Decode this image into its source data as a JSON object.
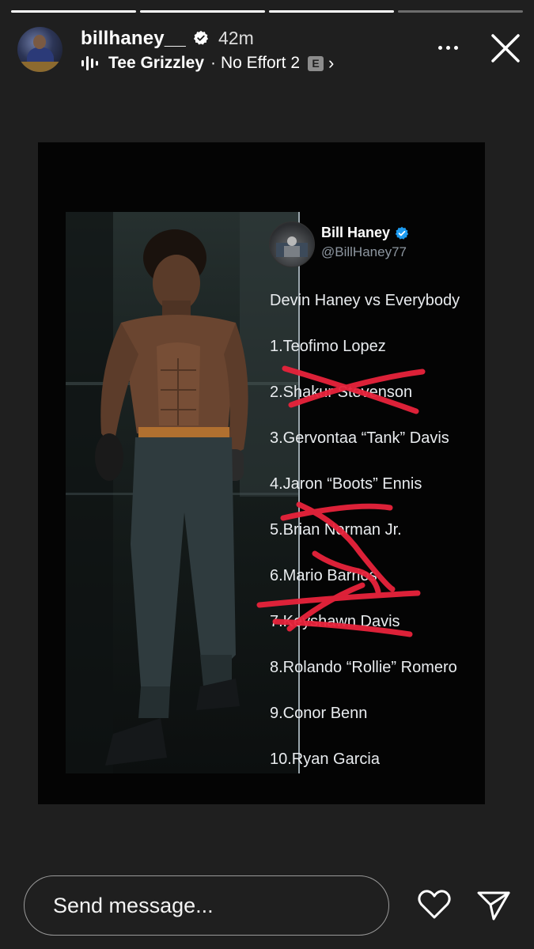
{
  "story": {
    "segments": [
      true,
      true,
      true,
      false
    ]
  },
  "header": {
    "username": "billhaney__",
    "time_ago": "42m",
    "music_artist": "Tee Grizzley",
    "music_separator": "·",
    "music_track": "No Effort 2",
    "explicit_label": "E",
    "chevron": "›"
  },
  "post": {
    "author_name": "Bill Haney",
    "author_handle": "@BillHaney77",
    "headline": "Devin Haney vs Everybody",
    "list": [
      {
        "text": "1.Teofimo Lopez",
        "crossed": false
      },
      {
        "text": "2.Shakur Stevenson",
        "crossed": true
      },
      {
        "text": "3.Gervontaa “Tank” Davis",
        "crossed": false
      },
      {
        "text": "4.Jaron “Boots” Ennis",
        "crossed": false
      },
      {
        "text": "5.Brian Norman Jr.",
        "crossed": true
      },
      {
        "text": "6.Mario Barrios",
        "crossed": true
      },
      {
        "text": "7.Keyshawn Davis",
        "crossed": true
      },
      {
        "text": "8.Rolando “Rollie” Romero",
        "crossed": false
      },
      {
        "text": "9.Conor Benn",
        "crossed": false
      },
      {
        "text": "10.Ryan Garcia",
        "crossed": false
      }
    ],
    "cross_color": "#e8233b",
    "verified_color": "#1d9bf0"
  },
  "footer": {
    "message_placeholder": "Send message..."
  }
}
